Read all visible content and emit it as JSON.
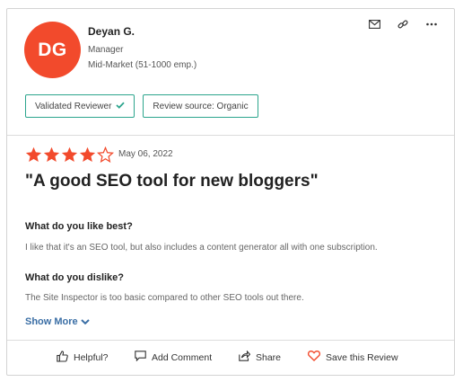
{
  "reviewer": {
    "initials": "DG",
    "name": "Deyan G.",
    "role": "Manager",
    "company_size": "Mid-Market (51-1000 emp.)",
    "avatar_color": "#f24a2c"
  },
  "top_actions": [
    {
      "icon": "envelope-icon"
    },
    {
      "icon": "link-icon"
    },
    {
      "icon": "more-icon"
    }
  ],
  "badges": {
    "validated": "Validated Reviewer",
    "source": "Review source: Organic"
  },
  "review": {
    "rating": 4,
    "rating_max": 5,
    "date": "May 06, 2022",
    "title": "\"A good SEO tool for new bloggers\"",
    "like_label": "What do you like best?",
    "like_text": "I like that it's an SEO tool, but also includes a content generator all with one subscription.",
    "dislike_label": "What do you dislike?",
    "dislike_text": "The Site Inspector is too basic compared to other SEO tools out there.",
    "show_more": "Show More"
  },
  "footer": {
    "helpful": "Helpful?",
    "add_comment": "Add Comment",
    "share": "Share",
    "save": "Save this Review"
  },
  "colors": {
    "star": "#f24a2c",
    "accent_green": "#2ca58d",
    "link_blue": "#3a6ea5"
  }
}
